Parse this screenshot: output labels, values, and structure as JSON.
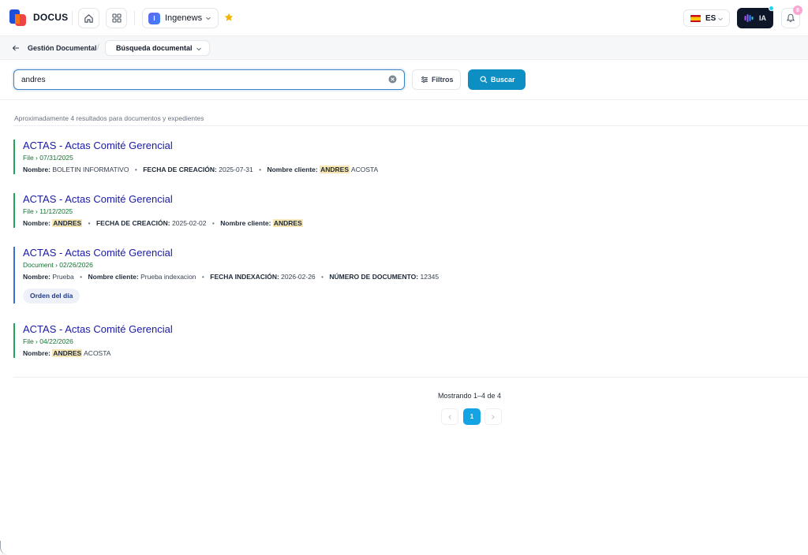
{
  "app": {
    "brand": "DOCUS",
    "workspace": {
      "initial": "I",
      "name": "Ingenews"
    },
    "language": "ES",
    "ai_label": "IA",
    "notifications_count": "8"
  },
  "breadcrumb": {
    "root": "Gestión Documental",
    "separator": "/",
    "current": "Búsqueda documental"
  },
  "search": {
    "value": "andres",
    "filters_label": "Filtros",
    "search_label": "Buscar"
  },
  "results_summary": "Aproximadamente 4 resultados para documentos y expedientes",
  "results": [
    {
      "title": "ACTAS - Actas Comité Gerencial",
      "path": "File › 07/31/2025",
      "meta": [
        {
          "label": "Nombre:",
          "value": "BOLETIN INFORMATIVO"
        },
        {
          "label": "FECHA DE CREACIÓN:",
          "value": "2025-07-31"
        },
        {
          "label": "Nombre cliente:",
          "highlight": "ANDRES",
          "value": "ACOSTA"
        }
      ]
    },
    {
      "title": "ACTAS - Actas Comité Gerencial",
      "path": "File › 11/12/2025",
      "meta": [
        {
          "label": "Nombre:",
          "highlight": "ANDRES"
        },
        {
          "label": "FECHA DE CREACIÓN:",
          "value": "2025-02-02"
        },
        {
          "label": "Nombre cliente:",
          "highlight": "ANDRES"
        }
      ]
    },
    {
      "title": "ACTAS - Actas Comité Gerencial",
      "path": "Document › 02/26/2026",
      "meta": [
        {
          "label": "Nombre:",
          "value": "Prueba"
        },
        {
          "label": "Nombre cliente:",
          "value": "Prueba indexacion"
        },
        {
          "label": "FECHA INDEXACIÓN:",
          "value": "2026-02-26"
        },
        {
          "label": "NÚMERO DE DOCUMENTO:",
          "value": "12345"
        }
      ],
      "tag": "Orden del día"
    },
    {
      "title": "ACTAS - Actas Comité Gerencial",
      "path": "File › 04/22/2026",
      "meta": [
        {
          "label": "Nombre:",
          "highlight": "ANDRES",
          "value": "ACOSTA"
        }
      ]
    }
  ],
  "pagination": {
    "summary": "Mostrando 1–4 de 4",
    "current_page": "1"
  },
  "colors": {
    "accent": "#0d8fc4",
    "file_bar": "#22a55a",
    "document_bar": "#3b6fd6",
    "title_link": "#1a1aa6",
    "highlight": "#f5e6b3"
  }
}
